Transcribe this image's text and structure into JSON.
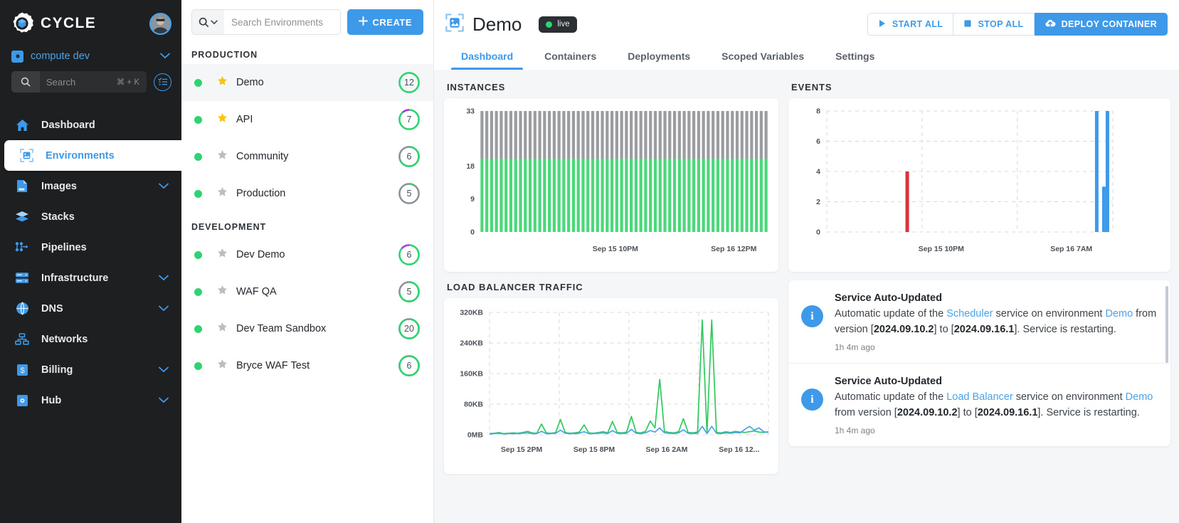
{
  "sidebar": {
    "logo_text": "CYCLE",
    "org": {
      "name": "compute dev"
    },
    "search": {
      "placeholder": "Search",
      "shortcut": "⌘ + K"
    },
    "items": [
      {
        "label": "Dashboard",
        "icon": "home-icon",
        "chevron": false
      },
      {
        "label": "Environments",
        "icon": "environments-icon",
        "chevron": false,
        "active": true
      },
      {
        "label": "Images",
        "icon": "images-icon",
        "chevron": true
      },
      {
        "label": "Stacks",
        "icon": "stacks-icon",
        "chevron": false
      },
      {
        "label": "Pipelines",
        "icon": "pipelines-icon",
        "chevron": false
      },
      {
        "label": "Infrastructure",
        "icon": "infrastructure-icon",
        "chevron": true
      },
      {
        "label": "DNS",
        "icon": "dns-icon",
        "chevron": true
      },
      {
        "label": "Networks",
        "icon": "networks-icon",
        "chevron": false
      },
      {
        "label": "Billing",
        "icon": "billing-icon",
        "chevron": true
      },
      {
        "label": "Hub",
        "icon": "hub-icon",
        "chevron": true
      }
    ]
  },
  "envlist": {
    "search_placeholder": "Search Environments",
    "create_label": "CREATE",
    "groups": [
      {
        "title": "PRODUCTION",
        "items": [
          {
            "name": "Demo",
            "count": "12",
            "starred": true,
            "selected": true,
            "status": "online",
            "ring": [
              {
                "color": "#2fd472",
                "pct": 100
              }
            ]
          },
          {
            "name": "API",
            "count": "7",
            "starred": true,
            "selected": false,
            "status": "online",
            "ring": [
              {
                "color": "#2fd472",
                "pct": 88
              },
              {
                "color": "#a23ce8",
                "pct": 12
              }
            ]
          },
          {
            "name": "Community",
            "count": "6",
            "starred": false,
            "selected": false,
            "status": "online",
            "ring": [
              {
                "color": "#2fd472",
                "pct": 68
              },
              {
                "color": "#8d9399",
                "pct": 32
              }
            ]
          },
          {
            "name": "Production",
            "count": "5",
            "starred": false,
            "selected": false,
            "status": "online",
            "ring": [
              {
                "color": "#2fd472",
                "pct": 8
              },
              {
                "color": "#8d9399",
                "pct": 92
              }
            ]
          }
        ]
      },
      {
        "title": "DEVELOPMENT",
        "items": [
          {
            "name": "Dev Demo",
            "count": "6",
            "starred": false,
            "selected": false,
            "status": "online",
            "ring": [
              {
                "color": "#2fd472",
                "pct": 86
              },
              {
                "color": "#a23ce8",
                "pct": 14
              }
            ]
          },
          {
            "name": "WAF QA",
            "count": "5",
            "starred": false,
            "selected": false,
            "status": "online",
            "ring": [
              {
                "color": "#2fd472",
                "pct": 72
              },
              {
                "color": "#8d9399",
                "pct": 28
              }
            ]
          },
          {
            "name": "Dev Team Sandbox",
            "count": "20",
            "starred": false,
            "selected": false,
            "status": "online",
            "ring": [
              {
                "color": "#2fd472",
                "pct": 92
              },
              {
                "color": "#8d9399",
                "pct": 8
              }
            ]
          },
          {
            "name": "Bryce WAF Test",
            "count": "6",
            "starred": false,
            "selected": false,
            "status": "online",
            "ring": [
              {
                "color": "#2fd472",
                "pct": 96
              },
              {
                "color": "#8d9399",
                "pct": 4
              }
            ]
          }
        ]
      }
    ]
  },
  "header": {
    "title": "Demo",
    "badge": "live",
    "buttons": [
      {
        "label": "START ALL",
        "icon": "play-icon",
        "primary": false
      },
      {
        "label": "STOP ALL",
        "icon": "stop-icon",
        "primary": false
      },
      {
        "label": "DEPLOY CONTAINER",
        "icon": "cloud-upload-icon",
        "primary": true
      }
    ],
    "tabs": [
      {
        "label": "Dashboard",
        "active": true
      },
      {
        "label": "Containers",
        "active": false
      },
      {
        "label": "Deployments",
        "active": false
      },
      {
        "label": "Scoped Variables",
        "active": false
      },
      {
        "label": "Settings",
        "active": false
      }
    ]
  },
  "sections": {
    "instances": "INSTANCES",
    "load_balancer": "LOAD BALANCER TRAFFIC",
    "events": "EVENTS"
  },
  "events_feed": [
    {
      "title": "Service Auto-Updated",
      "pre": "Automatic update of the ",
      "service": "Scheduler",
      "mid": " service on environment ",
      "env": "Demo",
      "mid2": " from version [",
      "from_version": "2024.09.10.2",
      "mid3": "] to [",
      "to_version": "2024.09.16.1",
      "post": "]. Service is restarting.",
      "time": "1h 4m ago"
    },
    {
      "title": "Service Auto-Updated",
      "pre": "Automatic update of the ",
      "service": "Load Balancer",
      "mid": " service on environment ",
      "env": "Demo",
      "mid2": " from version [",
      "from_version": "2024.09.10.2",
      "mid3": "] to [",
      "to_version": "2024.09.16.1",
      "post": "]. Service is restarting.",
      "time": "1h 4m ago"
    }
  ],
  "chart_data": [
    {
      "id": "instances",
      "type": "bar",
      "title": "INSTANCES",
      "stacked": true,
      "grid": false,
      "ylim": [
        0,
        33
      ],
      "yticks": [
        0,
        9,
        18,
        33
      ],
      "ytick_labels": [
        "0",
        "9",
        "18",
        "33"
      ],
      "xlabel": "",
      "ylabel": "",
      "xtick_labels": [
        "Sep 15 10PM",
        "Sep 16 12PM"
      ],
      "xtick_positions": [
        0.47,
        0.88
      ],
      "n_bars": 60,
      "series": [
        {
          "name": "running",
          "color": "#4bd87a",
          "values": [
            20,
            20,
            20,
            20,
            20,
            20,
            20,
            20,
            20,
            20,
            20,
            20,
            20,
            20,
            20,
            20,
            20,
            20,
            20,
            20,
            20,
            20,
            20,
            20,
            20,
            20,
            20,
            20,
            20,
            20,
            20,
            20,
            20,
            20,
            20,
            20,
            20,
            20,
            20,
            20,
            20,
            20,
            20,
            20,
            20,
            20,
            20,
            20,
            20,
            20,
            20,
            20,
            20,
            20,
            20,
            20,
            20,
            20,
            20,
            20
          ]
        },
        {
          "name": "stopped",
          "color": "#9a9ca0",
          "values": [
            13,
            13,
            13,
            13,
            13,
            13,
            13,
            13,
            13,
            13,
            13,
            13,
            13,
            13,
            13,
            13,
            13,
            13,
            13,
            13,
            13,
            13,
            13,
            13,
            13,
            13,
            13,
            13,
            13,
            13,
            13,
            13,
            13,
            13,
            13,
            13,
            13,
            13,
            13,
            13,
            13,
            13,
            13,
            13,
            13,
            13,
            13,
            13,
            13,
            13,
            13,
            13,
            13,
            13,
            13,
            13,
            13,
            13,
            13,
            13
          ]
        }
      ]
    },
    {
      "id": "events",
      "type": "bar",
      "title": "EVENTS",
      "grid": true,
      "ylim": [
        0,
        8
      ],
      "yticks": [
        0,
        2,
        4,
        6,
        8
      ],
      "ytick_labels": [
        "0",
        "2",
        "4",
        "6",
        "8"
      ],
      "xtick_labels": [
        "Sep 15 10PM",
        "Sep 16 7AM"
      ],
      "xtick_positions": [
        0.4,
        0.855
      ],
      "n_bars": 80,
      "bars": [
        {
          "index": 22,
          "value": 4,
          "color": "#d8323f"
        },
        {
          "index": 75,
          "value": 8,
          "color": "#3e9ae8"
        },
        {
          "index": 77,
          "value": 3,
          "color": "#3e9ae8"
        },
        {
          "index": 78,
          "value": 8,
          "color": "#3e9ae8"
        }
      ]
    },
    {
      "id": "load_balancer",
      "type": "line",
      "title": "LOAD BALANCER TRAFFIC",
      "grid": true,
      "ylim": [
        0,
        320
      ],
      "yticks": [
        0,
        80,
        160,
        240,
        320
      ],
      "ytick_labels": [
        "0MB",
        "80KB",
        "160KB",
        "240KB",
        "320KB"
      ],
      "xtick_labels": [
        "Sep 15 2PM",
        "Sep 15 8PM",
        "Sep 16 2AM",
        "Sep 16 12..."
      ],
      "xtick_positions": [
        0.115,
        0.375,
        0.635,
        0.895
      ],
      "series": [
        {
          "name": "green",
          "color": "#2fc95d",
          "values": [
            3,
            4,
            6,
            3,
            4,
            5,
            4,
            6,
            9,
            5,
            4,
            28,
            5,
            4,
            6,
            40,
            6,
            4,
            5,
            7,
            26,
            5,
            4,
            6,
            8,
            5,
            35,
            6,
            5,
            7,
            48,
            6,
            5,
            9,
            36,
            18,
            145,
            9,
            6,
            5,
            8,
            42,
            6,
            5,
            7,
            300,
            4,
            300,
            6,
            5,
            8,
            6,
            9,
            7,
            6,
            8,
            10,
            7,
            6,
            8
          ]
        },
        {
          "name": "blue",
          "color": "#4aa3e8",
          "values": [
            2,
            3,
            4,
            2,
            3,
            3,
            3,
            4,
            5,
            3,
            3,
            9,
            3,
            3,
            4,
            12,
            4,
            3,
            3,
            4,
            8,
            3,
            3,
            4,
            5,
            3,
            11,
            4,
            3,
            4,
            14,
            4,
            3,
            5,
            11,
            7,
            18,
            5,
            4,
            3,
            5,
            13,
            4,
            3,
            4,
            22,
            3,
            22,
            4,
            3,
            5,
            4,
            6,
            5,
            14,
            22,
            12,
            18,
            8,
            6
          ]
        }
      ]
    }
  ]
}
